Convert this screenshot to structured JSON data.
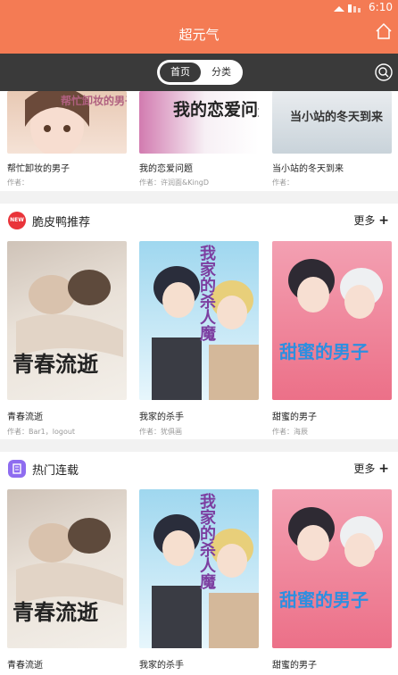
{
  "status_bar": {
    "time": "6:10"
  },
  "header": {
    "title": "超元气"
  },
  "tabs": [
    {
      "label": "首页"
    },
    {
      "label": "分类"
    }
  ],
  "top_row": [
    {
      "cover_text": "帮忙卸妆的男子",
      "name": "帮忙卸妆的男子",
      "author": "作者："
    },
    {
      "cover_text": "我的恋爱问题",
      "name": "我的恋爱问题",
      "author": "作者：许润面&KingD"
    },
    {
      "cover_text": "当小站的冬天到来",
      "name": "当小站的冬天到来",
      "author": "作者："
    }
  ],
  "sections": [
    {
      "title": "脆皮鸭推荐",
      "more": "更多",
      "items": [
        {
          "cover_text": "青春流逝",
          "name": "青春流逝",
          "author": "作者：Bar1，logout"
        },
        {
          "cover_text": "我家的杀人魔",
          "name": "我家的杀手",
          "author": "作者：犹俱画"
        },
        {
          "cover_text": "甜蜜的男子",
          "name": "甜蜜的男子",
          "author": "作者：海辰"
        }
      ]
    },
    {
      "title": "热门连载",
      "more": "更多",
      "items": [
        {
          "cover_text": "青春流逝",
          "name": "青春流逝",
          "author": ""
        },
        {
          "cover_text": "我家的杀人魔",
          "name": "我家的杀手",
          "author": ""
        },
        {
          "cover_text": "甜蜜的男子",
          "name": "甜蜜的男子",
          "author": ""
        }
      ]
    }
  ],
  "badges": {
    "new": "NEW"
  },
  "colors": {
    "accent": "#f47b54",
    "dark_bar": "#3a3a3a",
    "new_badge": "#e9343a",
    "hot_badge": "#8e6cf0"
  }
}
